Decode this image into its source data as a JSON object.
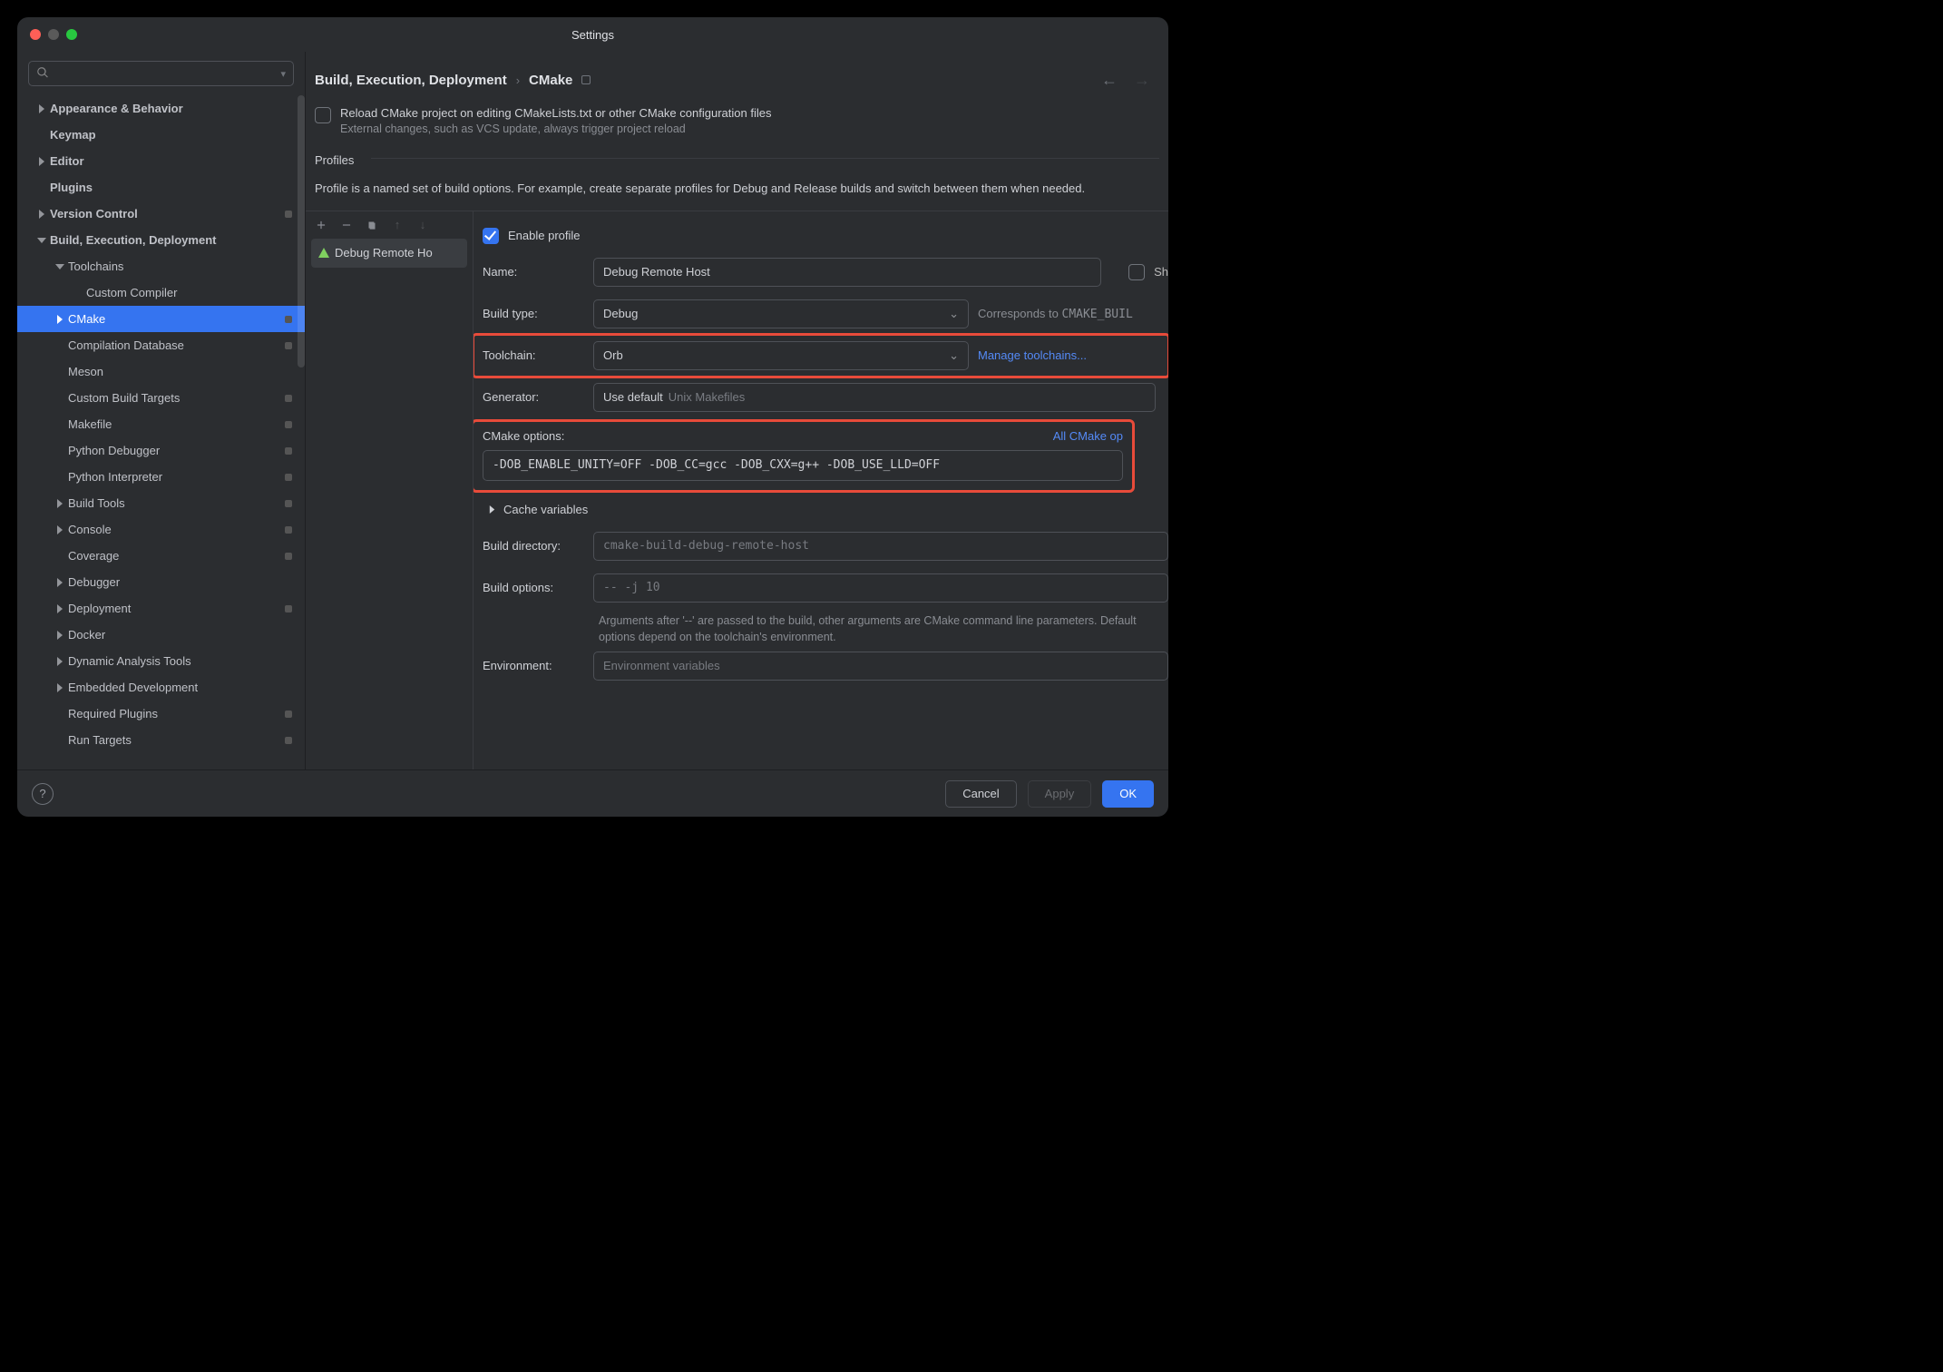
{
  "window": {
    "title": "Settings"
  },
  "search": {
    "placeholder": ""
  },
  "breadcrumbs": {
    "item1": "Build, Execution, Deployment",
    "item2": "CMake"
  },
  "sidebar": {
    "items": [
      {
        "label": "Appearance & Behavior",
        "indent": 0,
        "chevron": "right",
        "bold": true
      },
      {
        "label": "Keymap",
        "indent": 0,
        "bold": true
      },
      {
        "label": "Editor",
        "indent": 0,
        "chevron": "right",
        "bold": true
      },
      {
        "label": "Plugins",
        "indent": 0,
        "bold": true
      },
      {
        "label": "Version Control",
        "indent": 0,
        "chevron": "right",
        "bold": true,
        "reset": true
      },
      {
        "label": "Build, Execution, Deployment",
        "indent": 0,
        "chevron": "down",
        "bold": true
      },
      {
        "label": "Toolchains",
        "indent": 1,
        "chevron": "down"
      },
      {
        "label": "Custom Compiler",
        "indent": 2
      },
      {
        "label": "CMake",
        "indent": 1,
        "chevron": "right",
        "selected": true,
        "reset": true
      },
      {
        "label": "Compilation Database",
        "indent": 1,
        "reset": true
      },
      {
        "label": "Meson",
        "indent": 1
      },
      {
        "label": "Custom Build Targets",
        "indent": 1,
        "reset": true
      },
      {
        "label": "Makefile",
        "indent": 1,
        "reset": true
      },
      {
        "label": "Python Debugger",
        "indent": 1,
        "reset": true
      },
      {
        "label": "Python Interpreter",
        "indent": 1,
        "reset": true
      },
      {
        "label": "Build Tools",
        "indent": 1,
        "chevron": "right",
        "reset": true
      },
      {
        "label": "Console",
        "indent": 1,
        "chevron": "right",
        "reset": true
      },
      {
        "label": "Coverage",
        "indent": 1,
        "reset": true
      },
      {
        "label": "Debugger",
        "indent": 1,
        "chevron": "right"
      },
      {
        "label": "Deployment",
        "indent": 1,
        "chevron": "right",
        "reset": true
      },
      {
        "label": "Docker",
        "indent": 1,
        "chevron": "right"
      },
      {
        "label": "Dynamic Analysis Tools",
        "indent": 1,
        "chevron": "right"
      },
      {
        "label": "Embedded Development",
        "indent": 1,
        "chevron": "right"
      },
      {
        "label": "Required Plugins",
        "indent": 1,
        "reset": true
      },
      {
        "label": "Run Targets",
        "indent": 1,
        "reset": true
      }
    ]
  },
  "reload": {
    "label": "Reload CMake project on editing CMakeLists.txt or other CMake configuration files",
    "sub": "External changes, such as VCS update, always trigger project reload"
  },
  "profiles": {
    "title": "Profiles",
    "desc": "Profile is a named set of build options. For example, create separate profiles for Debug and Release builds and switch between them when needed.",
    "list": [
      {
        "label": "Debug Remote Ho"
      }
    ],
    "enable": "Enable profile",
    "sh": "Sh",
    "name_label": "Name:",
    "name_value": "Debug Remote Host",
    "buildtype_label": "Build type:",
    "buildtype_value": "Debug",
    "buildtype_hint_pre": "Corresponds to ",
    "buildtype_hint_mono": "CMAKE_BUIL",
    "toolchain_label": "Toolchain:",
    "toolchain_value": "Orb",
    "toolchain_link": "Manage toolchains...",
    "generator_label": "Generator:",
    "generator_use": "Use default",
    "generator_hint": "Unix Makefiles",
    "options_label": "CMake options:",
    "options_link": "All CMake op",
    "options_value": "-DOB_ENABLE_UNITY=OFF -DOB_CC=gcc -DOB_CXX=g++ -DOB_USE_LLD=OFF",
    "cache_label": "Cache variables",
    "builddir_label": "Build directory:",
    "builddir_ph": "cmake-build-debug-remote-host",
    "buildopts_label": "Build options:",
    "buildopts_ph": "-- -j 10",
    "buildopts_help": "Arguments after '--' are passed to the build, other arguments are CMake command line parameters. Default options depend on the toolchain's environment.",
    "env_label": "Environment:",
    "env_ph": "Environment variables"
  },
  "footer": {
    "cancel": "Cancel",
    "apply": "Apply",
    "ok": "OK"
  }
}
